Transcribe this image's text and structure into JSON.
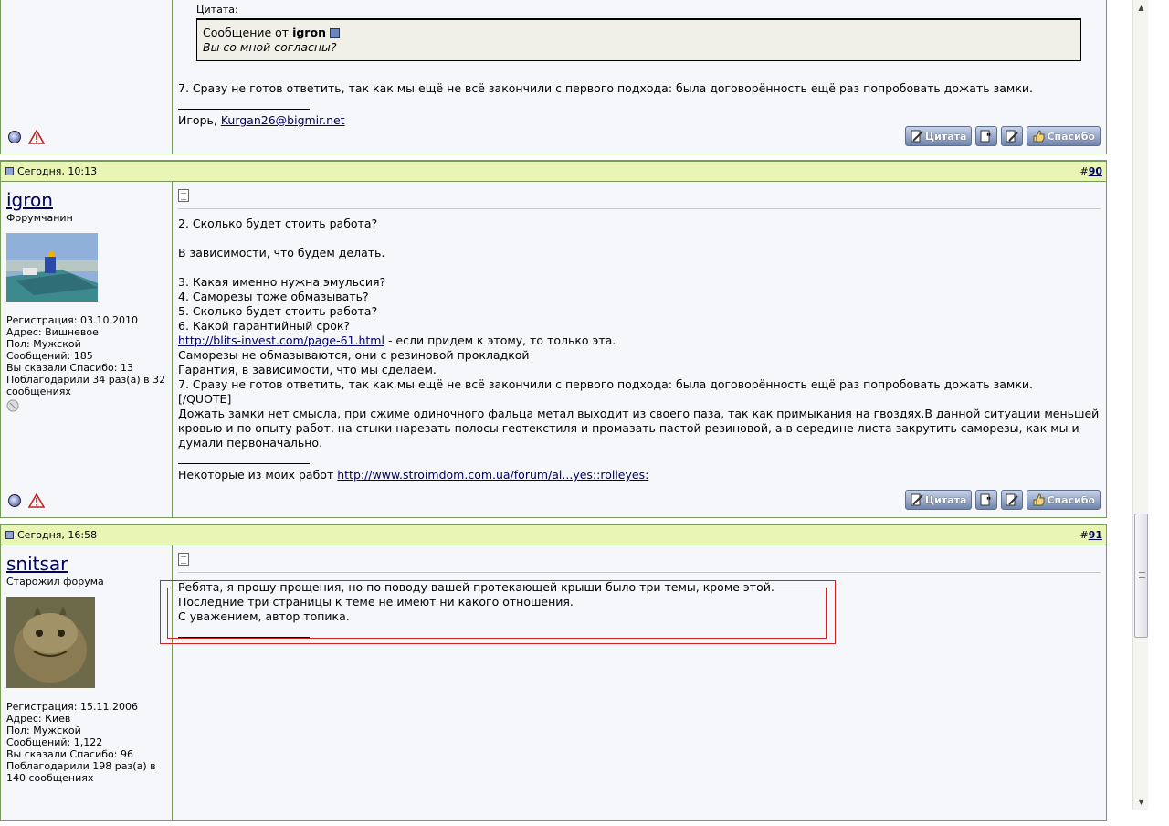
{
  "post1": {
    "quote_label": "Цитата:",
    "quote_from_prefix": "Сообщение от",
    "quote_author": "igron",
    "quote_text": "Вы со мной согласны?",
    "message": "7. Сразу не готов ответить, так как мы ещё не всё закончили с первого подхода: была договорённость ещё раз попробовать дожать замки.",
    "sig_prefix": "Игорь,",
    "sig_email": "Kurgan26@bigmir.net"
  },
  "post2": {
    "date": "Сегодня, 10:13",
    "number_prefix": "#",
    "number": "90",
    "username": "igron",
    "usertitle": "Форумчанин",
    "reg": "Регистрация: 03.10.2010",
    "address": "Адрес: Вишневое",
    "gender": "Пол: Мужской",
    "posts": "Сообщений: 185",
    "thanked": "Вы сказали Спасибо: 13",
    "thanks_received": "Поблагодарили 34 раз(а) в 32 сообщениях",
    "lines": [
      "2. Сколько будет стоить работа?",
      "",
      "В зависимости, что будем делать.",
      "",
      "3. Какая именно нужна эмульсия?",
      "4. Саморезы тоже обмазывать?",
      "5. Сколько будет стоить работа?",
      "6. Какой гарантийный срок?"
    ],
    "link": "http://blits-invest.com/page-61.html",
    "link_after": " - если придем к этому, то только эта.",
    "lines2": [
      "Саморезы не обмазываются, они с резиновой прокладкой",
      "Гарантия, в зависимости, что мы сделаем.",
      "7. Сразу не готов ответить, так как мы ещё не всё закончили с первого подхода: была договорённость ещё раз попробовать дожать замки.",
      "[/QUOTE]",
      "Дожать замки нет смысла, при сжиме одиночного фальца метал выходит из своего паза, так как примыкания на гвоздях.В данной ситуации меньшей кровью и по опыту работ, на стыки нарезать полосы геотекстиля и промазать пастой резиновой, а в середине листа закрутить саморезы, как мы и думали первоначально."
    ],
    "sig_prefix": "Некоторые из моих работ",
    "sig_link": "http://www.stroimdom.com.ua/forum/al...yes::rolleyes:"
  },
  "post3": {
    "date": "Сегодня, 16:58",
    "number_prefix": "#",
    "number": "91",
    "username": "snitsar",
    "usertitle": "Старожил форума",
    "reg": "Регистрация: 15.11.2006",
    "address": "Адрес: Киев",
    "gender": "Пол: Мужской",
    "posts": "Сообщений: 1,122",
    "thanked": "Вы сказали Спасибо: 96",
    "thanks_received": "Поблагодарили 198 раз(а) в 140 сообщениях",
    "lines": [
      "Ребята, я прошу прощения, но по поводу вашей протекающей крыши было три темы, кроме этой.",
      "Последние три страницы к теме не имеют ни какого отношения.",
      "С уважением, автор топика."
    ]
  },
  "buttons": {
    "quote": "Цитата",
    "thanks": "Спасибо"
  },
  "colors": {
    "header_bg": "#e9f5b4",
    "border": "#799c5b",
    "highlight": "#d32020"
  }
}
